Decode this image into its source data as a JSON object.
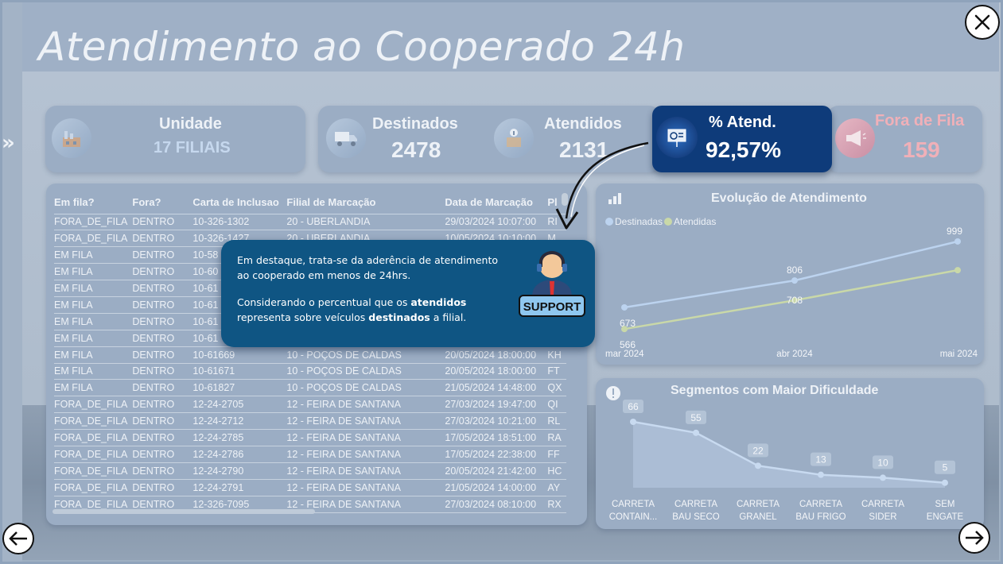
{
  "title": "Atendimento ao Cooperado 24h",
  "kpis": {
    "unidade": {
      "label": "Unidade",
      "value": "17 FILIAIS"
    },
    "destinados": {
      "label": "Destinados",
      "value": "2478"
    },
    "atendidos": {
      "label": "Atendidos",
      "value": "2131"
    },
    "pct_atend": {
      "label": "% Atend.",
      "value": "92,57%"
    },
    "fora_de_fila": {
      "label": "Fora de Fila",
      "value": "159"
    }
  },
  "table": {
    "columns": [
      "Em fila?",
      "Fora?",
      "Carta de Inclusao",
      "Filial de Marcação",
      "Data de Marcação",
      "Pl"
    ],
    "rows": [
      [
        "FORA_DE_FILA",
        "DENTRO",
        "10-326-1302",
        "20 - UBERLANDIA",
        "29/03/2024 10:07:00",
        "RI"
      ],
      [
        "FORA_DE_FILA",
        "DENTRO",
        "10-326-1427",
        "20 - UBERLANDIA",
        "10/05/2024 10:10:00",
        "M"
      ],
      [
        "EM FILA",
        "DENTRO",
        "10-58",
        "",
        "",
        ""
      ],
      [
        "EM FILA",
        "DENTRO",
        "10-60",
        "",
        "",
        ""
      ],
      [
        "EM FILA",
        "DENTRO",
        "10-61",
        "",
        "",
        ""
      ],
      [
        "EM FILA",
        "DENTRO",
        "10-61",
        "",
        "",
        ""
      ],
      [
        "EM FILA",
        "DENTRO",
        "10-61",
        "",
        "",
        ""
      ],
      [
        "EM FILA",
        "DENTRO",
        "10-61",
        "",
        "",
        ""
      ],
      [
        "EM FILA",
        "DENTRO",
        "10-61669",
        "10 - POÇOS DE CALDAS",
        "20/05/2024 18:00:00",
        "KH"
      ],
      [
        "EM FILA",
        "DENTRO",
        "10-61671",
        "10 - POÇOS DE CALDAS",
        "20/05/2024 18:00:00",
        "FT"
      ],
      [
        "EM FILA",
        "DENTRO",
        "10-61827",
        "10 - POÇOS DE CALDAS",
        "21/05/2024 14:48:00",
        "QX"
      ],
      [
        "FORA_DE_FILA",
        "DENTRO",
        "12-24-2705",
        "12 - FEIRA DE SANTANA",
        "27/03/2024 19:47:00",
        "QI"
      ],
      [
        "FORA_DE_FILA",
        "DENTRO",
        "12-24-2712",
        "12 - FEIRA DE SANTANA",
        "27/03/2024 10:21:00",
        "RL"
      ],
      [
        "FORA_DE_FILA",
        "DENTRO",
        "12-24-2785",
        "12 - FEIRA DE SANTANA",
        "17/05/2024 18:51:00",
        "RA"
      ],
      [
        "FORA_DE_FILA",
        "DENTRO",
        "12-24-2786",
        "12 - FEIRA DE SANTANA",
        "17/05/2024 22:38:00",
        "FF"
      ],
      [
        "FORA_DE_FILA",
        "DENTRO",
        "12-24-2790",
        "12 - FEIRA DE SANTANA",
        "20/05/2024 21:42:00",
        "HC"
      ],
      [
        "FORA_DE_FILA",
        "DENTRO",
        "12-24-2791",
        "12 - FEIRA DE SANTANA",
        "21/05/2024 14:00:00",
        "AY"
      ],
      [
        "FORA_DE_FILA",
        "DENTRO",
        "12-326-7095",
        "12 - FEIRA DE SANTANA",
        "27/03/2024 08:10:00",
        "RX"
      ]
    ]
  },
  "callout": {
    "line1": "Em destaque, trata-se da aderência de atendimento ao cooperado em menos de 24hrs.",
    "line2_pre": "Considerando o percentual que os ",
    "line2_b1": "atendidos",
    "line2_mid": " representa sobre veículos ",
    "line2_b2": "destinados",
    "line2_post": " a filial.",
    "badge": "SUPPORT"
  },
  "evolucao": {
    "title": "Evolução de Atendimento",
    "legend": [
      "Destinadas",
      "Atendidas"
    ]
  },
  "segmentos": {
    "title": "Segmentos com Maior Dificuldade"
  },
  "chart_data": [
    {
      "type": "line",
      "title": "Evolução de Atendimento",
      "categories": [
        "mar 2024",
        "abr 2024",
        "mai 2024"
      ],
      "series": [
        {
          "name": "Destinadas",
          "values": [
            673,
            806,
            999
          ],
          "color": "#bcd3ef"
        },
        {
          "name": "Atendidas",
          "values": [
            566,
            708,
            857
          ],
          "color": "#c9d8a8"
        }
      ]
    },
    {
      "type": "area",
      "title": "Segmentos com Maior Dificuldade",
      "categories": [
        "CARRETA CONTAIN...",
        "CARRETA BAU SECO",
        "CARRETA GRANEL",
        "CARRETA BAU FRIGO",
        "CARRETA SIDER",
        "SEM ENGATE"
      ],
      "values": [
        66,
        55,
        22,
        13,
        10,
        5
      ],
      "color": "#b8cbe4"
    }
  ],
  "colors": {
    "highlight": "#0e3b7a",
    "callout": "#0f5583",
    "fora_de_fila": "#f0b0b8"
  }
}
